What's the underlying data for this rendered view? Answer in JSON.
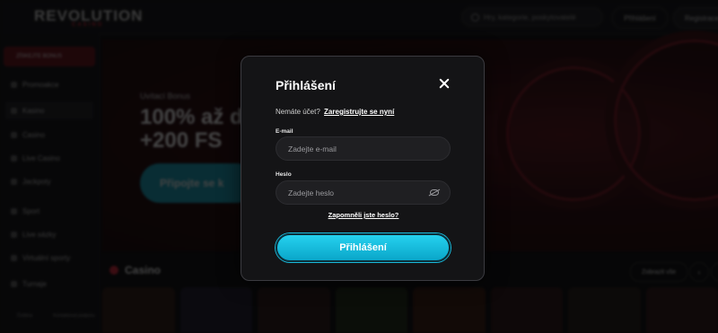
{
  "background": {
    "logo": "REVOLUTION",
    "logo_sub": "CASINO",
    "search_placeholder": "Hry, kategorie, poskytovatelé",
    "topbar_login": "Přihlášení",
    "topbar_register": "Registrace",
    "sidebar_promo": "ZÍSKEJTE BONUS",
    "sidebar_items": [
      "Promoakce",
      "Kasino",
      "Casino",
      "Live Casino",
      "Jackpoty",
      "Sport",
      "Live sázky",
      "Virtuální sporty",
      "Turnaje"
    ],
    "sidebar_bottom": [
      "Čeština",
      "Kontaktovat podporu"
    ],
    "banner_small": "Uvítací Bonus",
    "banner_line1": "100% až d",
    "banner_line2": "+200 FS",
    "banner_button": "Připojte se k",
    "section_title": "Casino",
    "all_button": "Zobrazit vše",
    "arrow_left": "‹",
    "arrow_right": "›"
  },
  "modal": {
    "title": "Přihlášení",
    "no_account_text": "Nemáte účet?",
    "register_link": "Zaregistrujte se nyní",
    "email_label": "E-mail",
    "email_placeholder": "Zadejte e-mail",
    "password_label": "Heslo",
    "password_placeholder": "Zadejte heslo",
    "forgot_link": "Zapomněli jste heslo?",
    "submit_label": "Přihlášení"
  },
  "colors": {
    "accent": "#1fc6e6",
    "brand_red": "#e0263c",
    "modal_bg": "#141416"
  },
  "icons": [
    "close-icon",
    "eye-slash-icon",
    "search-icon"
  ]
}
